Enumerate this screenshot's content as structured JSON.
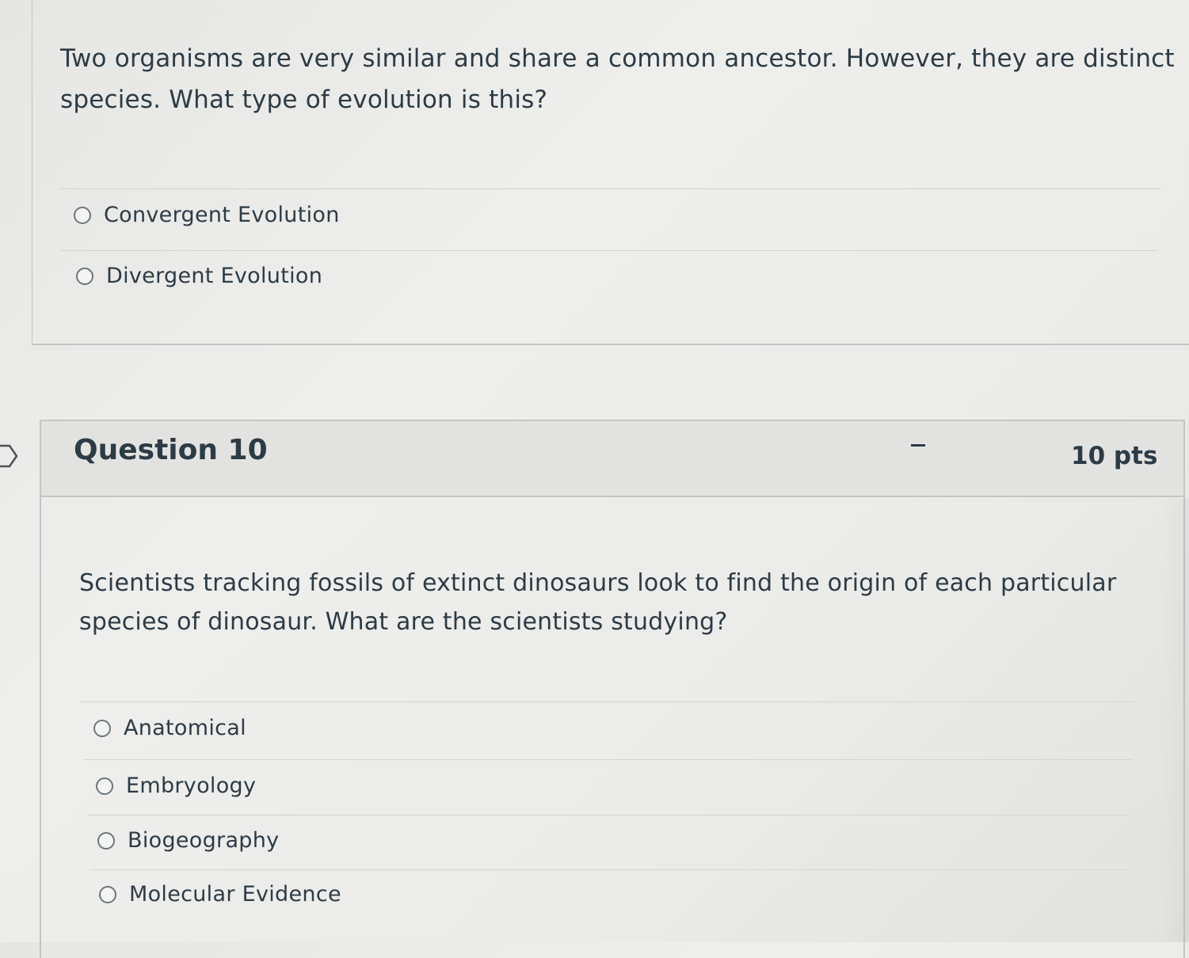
{
  "question9": {
    "text": "Two organisms are very similar and share a common ancestor. However, they are distinct species. What type of evolution is this?",
    "answers": [
      {
        "label": "Convergent Evolution",
        "selected": false
      },
      {
        "label": "Divergent Evolution",
        "selected": false
      }
    ]
  },
  "question10": {
    "title": "Question 10",
    "points": "10 pts",
    "text": "Scientists tracking fossils of extinct dinosaurs look to find the origin of each particular species of dinosaur. What are the scientists studying?",
    "answers": [
      {
        "label": "Anatomical",
        "selected": false
      },
      {
        "label": "Embryology",
        "selected": false
      },
      {
        "label": "Biogeography",
        "selected": false
      },
      {
        "label": "Molecular Evidence",
        "selected": false
      }
    ]
  },
  "icons": {
    "flag_marker": "bookmark-flag-icon",
    "radio": "radio-unselected-icon"
  },
  "colors": {
    "text": "#2d3b45",
    "header_bg": "#e2e3e1",
    "border": "#c4c6c4",
    "page_bg": "#ebebe9"
  }
}
